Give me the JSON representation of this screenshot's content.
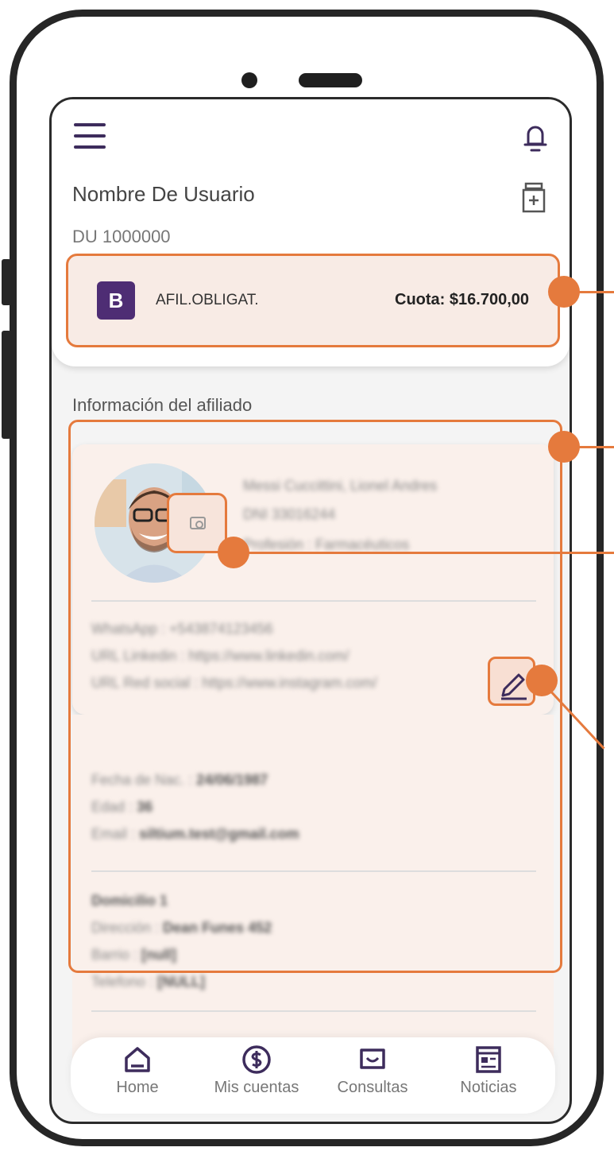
{
  "header": {
    "user_name": "Nombre De Usuario",
    "du_number": "DU 1000000"
  },
  "plan": {
    "badge": "B",
    "type": "AFIL.OBLIGAT.",
    "fee": "Cuota: $16.700,00"
  },
  "section": {
    "title": "Información del afiliado"
  },
  "profile": {
    "name": "Messi Cuccittini, Lionel Andres",
    "dni": "DNI 33016244",
    "profession": "Profesión : Farmacéuticos"
  },
  "contacts": [
    "WhatsApp : +543874123456",
    "URL Linkedin : https://www.linkedin.com/",
    "URL Red social : https://www.instagram.com/"
  ],
  "personal": {
    "birth_label": "Fecha de Nac. :",
    "birth_value": "24/06/1987",
    "age_label": "Edad :",
    "age_value": "36",
    "email_label": "Email :",
    "email_value": "siltium.test@gmail.com"
  },
  "address": {
    "title": "Domicilio 1",
    "street_label": "Dirección :",
    "street_value": "Dean Funes 452",
    "district_label": "Barrio :",
    "district_value": "[null]",
    "phone_label": "Telefono :",
    "phone_value": "[NULL]"
  },
  "nav": [
    {
      "label": "Home",
      "icon": "home-icon"
    },
    {
      "label": "Mis cuentas",
      "icon": "dollar-icon"
    },
    {
      "label": "Consultas",
      "icon": "chat-icon"
    },
    {
      "label": "Noticias",
      "icon": "news-icon"
    }
  ],
  "colors": {
    "accent": "#e57a3d",
    "brand": "#4e2d74",
    "highlight_bg": "#f8ebe5"
  }
}
